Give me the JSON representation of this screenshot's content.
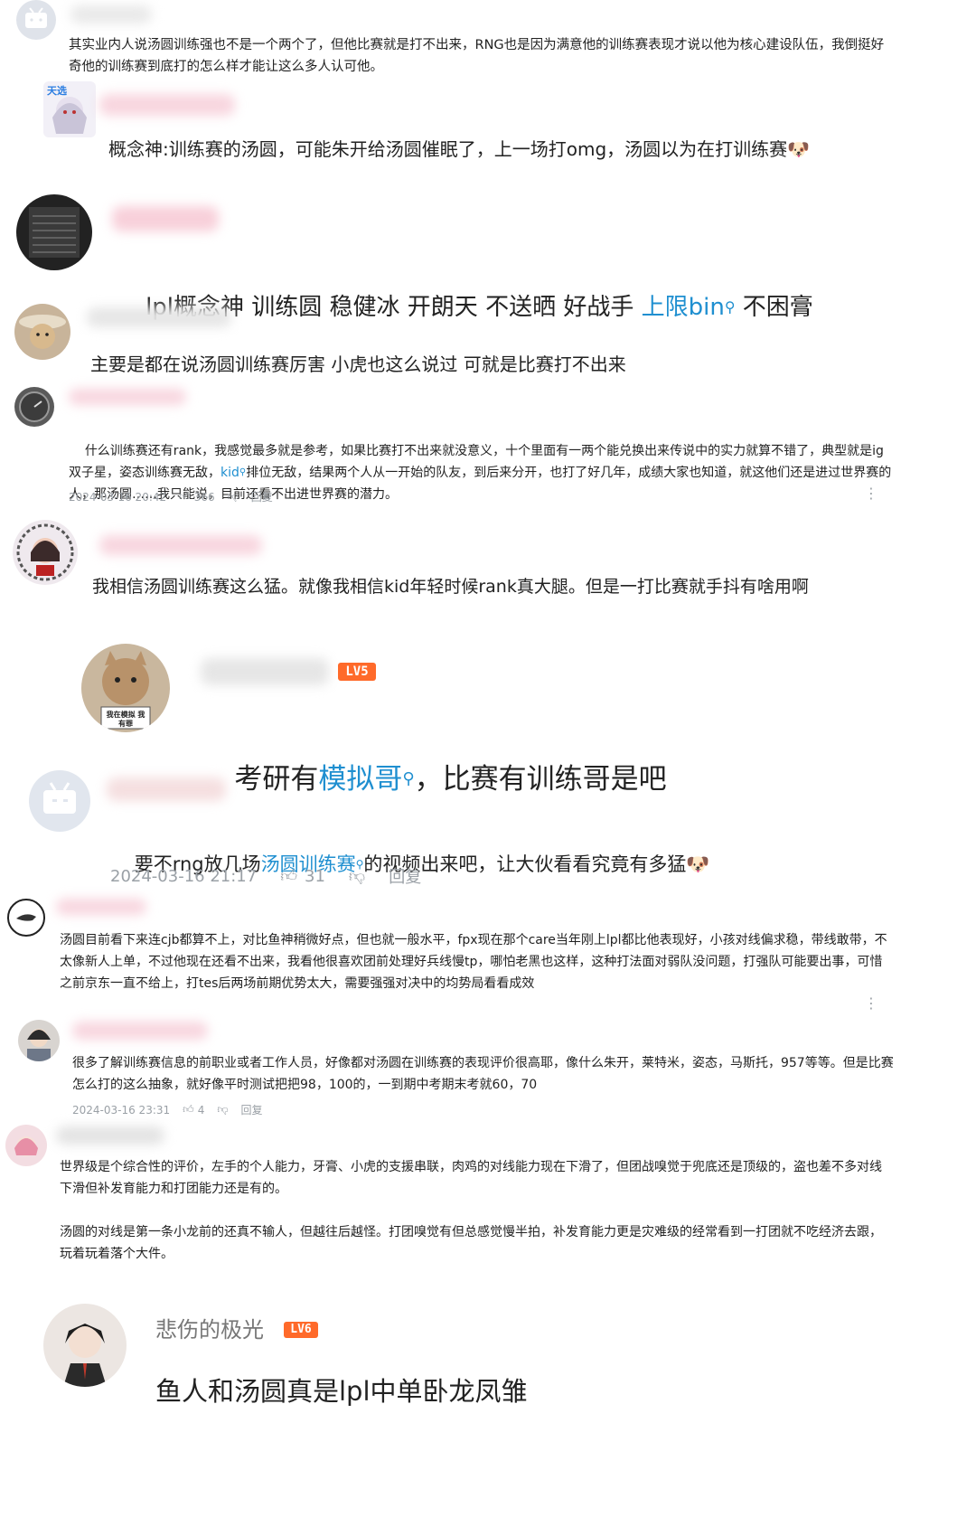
{
  "colors": {
    "link": "#1f8fd0",
    "muted": "#9aa0a6",
    "level_badge": "#ff6a2a",
    "text": "#222222"
  },
  "comments": [
    {
      "text": "其实业内人说汤圆训练强也不是一个两个了，但他比赛就是打不出来，RNG也是因为满意他的训练赛表现才说以他为核心建设队伍，我倒挺好奇他的训练赛到底打的怎么样才能让这么多人认可他。"
    },
    {
      "text": "概念神:训练赛的汤圆，可能朱开给汤圆催眠了，上一场打omg，汤圆以为在打训练赛🐶"
    },
    {
      "text_a": "lpl概念神 训练圆 稳健冰 开朗天 不送晒 好战手 ",
      "link": "上限bin",
      "text_b": " 不困膏"
    },
    {
      "text": "主要是都在说汤圆训练赛厉害 小虎也这么说过 可就是比赛打不出来"
    },
    {
      "text_a": "什么训练赛还有rank，我感觉最多就是参考，如果比赛打不出来就没意义，十个里面有一两个能兑换出来传说中的实力就算不错了，典型就是ig双子星，姿态训练赛无敌，",
      "link": "kid",
      "text_b": "排位无敌，结果两个人从一开始的队友，到后来分开，也打了好几年，成绩大家也知道，就这他们还是进过世界赛的人，那汤圆……我只能说，目前还看不出进世界赛的潜力。",
      "date": "2024-03-16 20:42",
      "likes": "366",
      "reply": "回复"
    },
    {
      "text": "我相信汤圆训练赛这么猛。就像我相信kid年轻时候rank真大腿。但是一打比赛就手抖有啥用啊"
    },
    {
      "level": "LV5",
      "avatar_caption": "我在模拟 我有罪",
      "text_a": "考研有",
      "link": "模拟哥",
      "text_b": "，比赛有训练哥是吧"
    },
    {
      "text_a": "要不rng放几场",
      "link": "汤圆训练赛",
      "text_b": "的视频出来吧，让大伙看看究竟有多猛🐶",
      "date": "2024-03-16 21:17",
      "likes": "31",
      "reply": "回复"
    },
    {
      "text": "汤圆目前看下来连cjb都算不上，对比鱼神稍微好点，但也就一般水平，fpx现在那个care当年刚上lpl都比他表现好，小孩对线偏求稳，带线敢带，不太像新人上单，不过他现在还看不出来，我看他很喜欢团前处理好兵线慢tp，哪怕老黑也这样，这种打法面对弱队没问题，打强队可能要出事，可惜之前京东一直不给上，打tes后两场前期优势太大，需要强强对决中的均势局看看成效"
    },
    {
      "text": "很多了解训练赛信息的前职业或者工作人员，好像都对汤圆在训练赛的表现评价很高耶，像什么朱开，莱特米，姿态，马斯托，957等等。但是比赛怎么打的这么抽象，就好像平时测试把把98，100的，一到期中考期末考就60，70",
      "date": "2024-03-16 23:31",
      "likes": "4",
      "reply": "回复"
    },
    {
      "text": "世界级是个综合性的评价，左手的个人能力，牙膏、小虎的支援串联，肉鸡的对线能力现在下滑了，但团战嗅觉于兜底还是顶级的，盗也差不多对线下滑但补发育能力和打团能力还是有的。",
      "text2": "汤圆的对线是第一条小龙前的还真不输人，但越往后越怪。打团嗅觉有但总感觉慢半拍，补发育能力更是灾难级的经常看到一打团就不吃经济去跟，玩着玩着落个大件。"
    },
    {
      "username": "悲伤的极光",
      "level": "LV6",
      "text": "鱼人和汤圆真是lpl中单卧龙凤雏"
    }
  ]
}
